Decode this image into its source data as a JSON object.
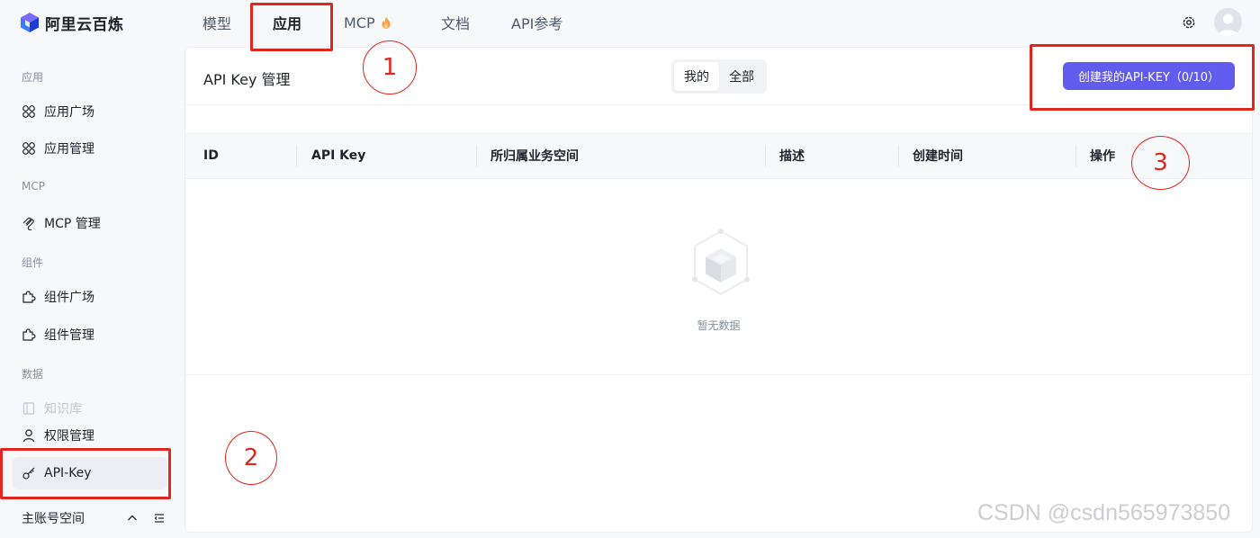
{
  "brand": {
    "name": "阿里云百炼"
  },
  "nav": {
    "items": [
      {
        "label": "模型"
      },
      {
        "label": "应用"
      },
      {
        "label": "MCP"
      },
      {
        "label": "文档"
      },
      {
        "label": "API参考"
      }
    ],
    "active": "应用"
  },
  "sidebar": {
    "sections": [
      {
        "title": "应用",
        "items": [
          "应用广场",
          "应用管理"
        ]
      },
      {
        "title": "MCP",
        "items": [
          "MCP 管理"
        ]
      },
      {
        "title": "组件",
        "items": [
          "组件广场",
          "组件管理"
        ]
      },
      {
        "title": "数据",
        "items": [
          "知识库",
          "权限管理",
          "API-Key"
        ]
      }
    ],
    "active_item": "API-Key",
    "disabled_item": "知识库",
    "footer_label": "主账号空间"
  },
  "main": {
    "title": "API Key 管理",
    "filter": {
      "options": [
        "我的",
        "全部"
      ],
      "selected": "我的"
    },
    "create_button": "创建我的API-KEY（0/10）",
    "table": {
      "columns": [
        "ID",
        "API Key",
        "所归属业务空间",
        "描述",
        "创建时间",
        "操作"
      ],
      "rows": [],
      "empty_text": "暂无数据"
    }
  },
  "annotations": {
    "labels": [
      "1",
      "2",
      "3"
    ],
    "color": "#e0261f"
  },
  "watermark": "CSDN @csdn565973850",
  "colors": {
    "primary": "#615ced",
    "background": "#f7f8fa"
  }
}
